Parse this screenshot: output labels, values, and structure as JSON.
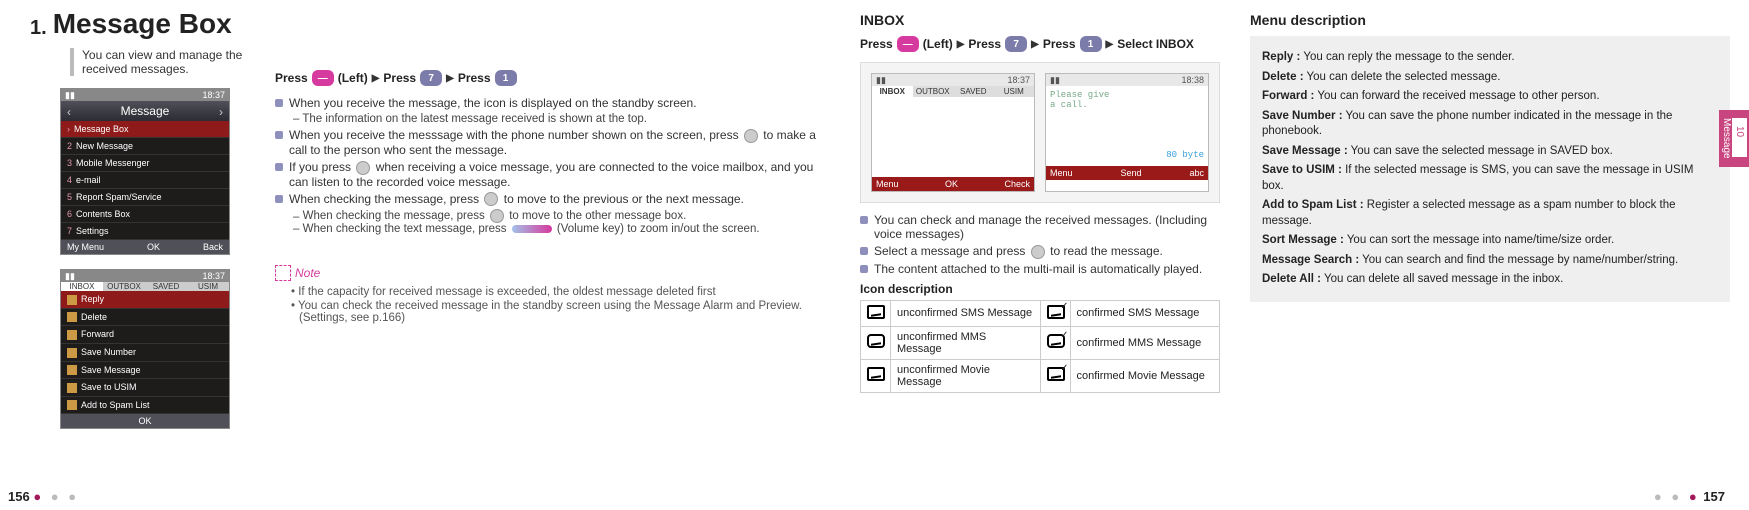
{
  "header": {
    "section_number": "1.",
    "title": "Message Box",
    "tagline": "You can view and manage the received messages."
  },
  "steps_left": {
    "press": "Press",
    "left_label": "(Left)",
    "key7_label": "7",
    "key_msg_label": ""
  },
  "left_bullets": {
    "b1": "When you receive the message, the icon is displayed on the standby screen.",
    "b1s1": "The information on the latest message received is shown at the top.",
    "b2a": "When you receive the messsage with the phone number shown on the screen, press",
    "b2b": "to make a call to the person who sent the message.",
    "b3a": "If you press",
    "b3b": "when receiving a voice message, you are connected to the voice mailbox, and you can listen to the recorded voice message.",
    "b4a": "When checking the message, press",
    "b4b": "to move to the previous or the next message.",
    "b4s1a": "When checking the message, press",
    "b4s1b": "to move to the other message box.",
    "b4s2a": "When checking the text message, press",
    "b4s2b": "(Volume key) to zoom in/out the screen."
  },
  "note": {
    "label": "Note",
    "n1": "If the capacity for received message is exceeded, the oldest message deleted first",
    "n2": "You can check the received message in the standby screen using the Message Alarm and Preview.(Settings, see p.166)"
  },
  "phone1": {
    "time": "18:37",
    "title": "Message",
    "rows": [
      "Message Box",
      "New Message",
      "Mobile Messenger",
      "e-mail",
      "Report Spam/Service",
      "Contents Box",
      "Settings"
    ],
    "soft": [
      "My Menu",
      "OK",
      "Back"
    ]
  },
  "phone2": {
    "time": "18:37",
    "tabs": [
      "INBOX",
      "OUTBOX",
      "SAVED",
      "USIM"
    ],
    "rows": [
      "Reply",
      "Delete",
      "Forward",
      "Save Number",
      "Save Message",
      "Save to USIM",
      "Add to Spam List"
    ],
    "soft_mid": "OK"
  },
  "inbox": {
    "heading": "INBOX",
    "steps": {
      "press": "Press",
      "left": "(Left)",
      "select": "Select INBOX"
    },
    "dual": {
      "left": {
        "tabs": [
          "INBOX",
          "OUTBOX",
          "SAVED",
          "USIM"
        ],
        "time": "18:37",
        "soft": [
          "Menu",
          "OK",
          "Check"
        ]
      },
      "right": {
        "time": "18:38",
        "body_line1": "Please give",
        "body_line2": "a call.",
        "byte": "80 byte",
        "soft": [
          "Menu",
          "Send",
          "abc"
        ]
      }
    },
    "bullets": {
      "b1": "You can check and manage the received messages. (Including voice messages)",
      "b2a": "Select a message and press",
      "b2b": "to read the message.",
      "b3": "The content attached to the multi-mail is automatically played."
    },
    "icon_heading": "Icon description",
    "icons": {
      "r1a": "unconfirmed SMS Message",
      "r1b": "confirmed SMS Message",
      "r2a": "unconfirmed MMS Message",
      "r2b": "confirmed MMS Message",
      "r3a": "unconfirmed Movie Message",
      "r3b": "confirmed Movie Message"
    }
  },
  "menu": {
    "heading": "Menu description",
    "items": {
      "reply": {
        "t": "Reply :",
        "d": "You can reply the message to the sender."
      },
      "delete": {
        "t": "Delete :",
        "d": "You can delete the selected message."
      },
      "forward": {
        "t": "Forward :",
        "d": "You can forward the received message to other person."
      },
      "savenum": {
        "t": "Save Number :",
        "d": "You can save the phone number indicated in the message in the phonebook."
      },
      "savemsg": {
        "t": "Save Message :",
        "d": "You can save the selected message in SAVED box."
      },
      "usim": {
        "t": "Save to USIM :",
        "d": "If the selected message is SMS, you can save the message in USIM box."
      },
      "spam": {
        "t": "Add to Spam List :",
        "d": "Register a selected message as a spam number to block the message."
      },
      "sort": {
        "t": "Sort Message :",
        "d": "You can sort the message into name/time/size order."
      },
      "search": {
        "t": "Message Search :",
        "d": "You can search and find the message by name/number/string."
      },
      "delall": {
        "t": "Delete All :",
        "d": "You can delete all saved message in the inbox."
      }
    }
  },
  "side_tab": {
    "chapter": "10",
    "label": "Message"
  },
  "page_left": "156",
  "page_right": "157"
}
